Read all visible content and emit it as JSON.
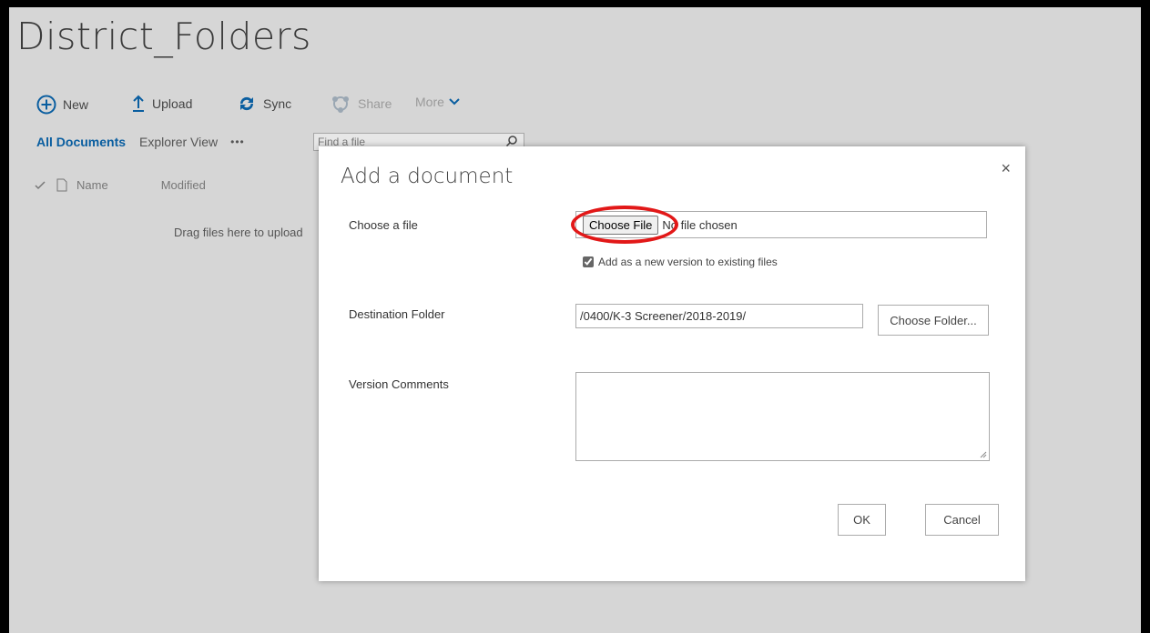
{
  "page": {
    "title": "District_Folders"
  },
  "commands": {
    "new": "New",
    "upload": "Upload",
    "sync": "Sync",
    "share": "Share",
    "more": "More"
  },
  "views": {
    "all_documents": "All Documents",
    "explorer_view": "Explorer View",
    "more": "•••"
  },
  "search": {
    "placeholder": "Find a file"
  },
  "columns": {
    "name": "Name",
    "modified": "Modified"
  },
  "drag_text": "Drag files here to upload",
  "dialog": {
    "title": "Add a document",
    "close": "×",
    "choose_file_label": "Choose a file",
    "choose_file_button": "Choose File",
    "no_file": "No file chosen",
    "add_version_label": "Add as a new version to existing files",
    "add_version_checked": true,
    "destination_label": "Destination Folder",
    "destination_value": "/0400/K-3 Screener/2018-2019/",
    "choose_folder_button": "Choose Folder...",
    "version_comments_label": "Version Comments",
    "version_comments_value": "",
    "ok": "OK",
    "cancel": "Cancel"
  },
  "colors": {
    "accent": "#0a5ea0",
    "highlight_ring": "#e21818",
    "backdrop": "#d6d6d6"
  }
}
